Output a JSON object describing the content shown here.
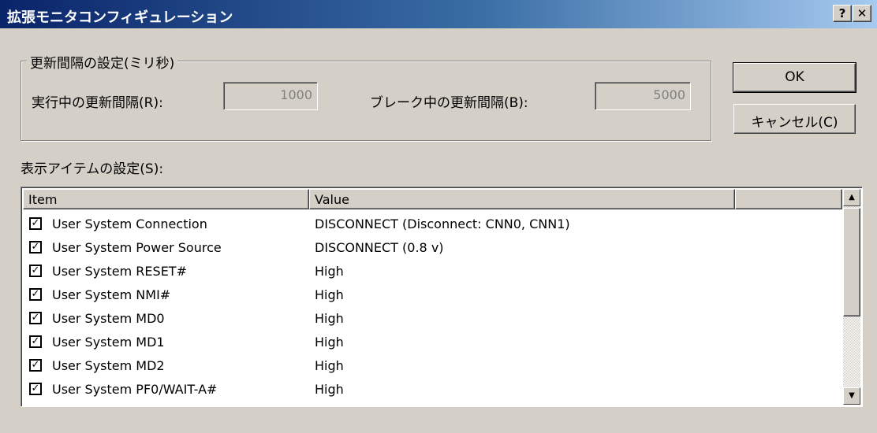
{
  "window": {
    "title": "拡張モニタコンフィギュレーション",
    "help_button": "?",
    "close_button": "✕"
  },
  "interval_group": {
    "legend": "更新間隔の設定(ミリ秒)",
    "running_label": "実行中の更新間隔(R):",
    "running_value": "1000",
    "break_label": "ブレーク中の更新間隔(B):",
    "break_value": "5000"
  },
  "buttons": {
    "ok": "OK",
    "cancel": "キャンセル(C)"
  },
  "items_section": {
    "label": "表示アイテムの設定(S):"
  },
  "list": {
    "columns": [
      "Item",
      "Value",
      ""
    ],
    "rows": [
      {
        "checked": true,
        "item": "User System Connection",
        "value": "DISCONNECT (Disconnect: CNN0, CNN1)"
      },
      {
        "checked": true,
        "item": "User System Power Source",
        "value": "DISCONNECT (0.8 v)"
      },
      {
        "checked": true,
        "item": "User System RESET#",
        "value": "High"
      },
      {
        "checked": true,
        "item": "User System NMI#",
        "value": "High"
      },
      {
        "checked": true,
        "item": "User System MD0",
        "value": "High"
      },
      {
        "checked": true,
        "item": "User System MD1",
        "value": "High"
      },
      {
        "checked": true,
        "item": "User System MD2",
        "value": "High"
      },
      {
        "checked": true,
        "item": "User System PF0/WAIT-A#",
        "value": "High"
      }
    ],
    "scroll_up_icon": "▲",
    "scroll_down_icon": "▼",
    "check_glyph": "✓"
  }
}
